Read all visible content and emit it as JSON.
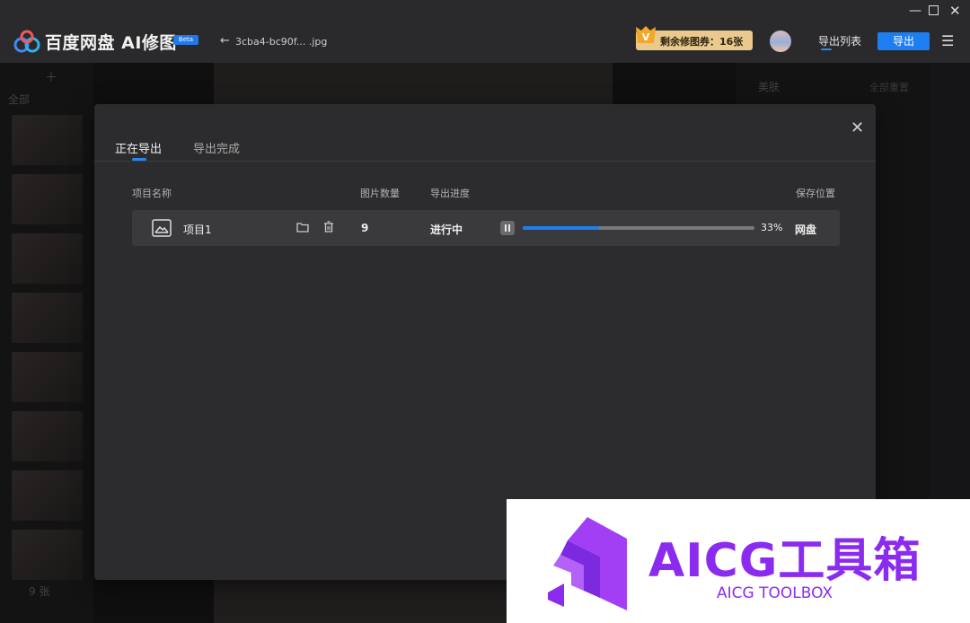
{
  "window": {
    "app_name": "百度网盘 AI修图",
    "beta_badge": "Beta",
    "file_name": "3cba4-bc90f... .jpg",
    "coupon_text": "剩余修图券：16张",
    "export_list_label": "导出列表",
    "export_button": "导出",
    "controls": [
      "minimize-icon",
      "maximize-icon",
      "close-icon"
    ]
  },
  "background": {
    "sidebar_all_label": "全部",
    "sidebar_count_label": "9 张",
    "right_panel_title": "美肤",
    "right_panel_reset": "全部重置"
  },
  "export_dialog": {
    "tabs": [
      {
        "label": "正在导出",
        "active": true
      },
      {
        "label": "导出完成",
        "active": false
      }
    ],
    "columns": {
      "name": "项目名称",
      "count": "图片数量",
      "progress": "导出进度",
      "location": "保存位置"
    },
    "rows": [
      {
        "name": "项目1",
        "count": "9",
        "status": "进行中",
        "progress_percent": 33,
        "progress_label": "33%",
        "location": "网盘"
      }
    ]
  },
  "watermark": {
    "title": "AICG工具箱",
    "subtitle": "AICG TOOLBOX"
  },
  "colors": {
    "accent": "#1d7ef2",
    "coupon_bg": "#e9c98d",
    "watermark": "#8c2bf0"
  }
}
